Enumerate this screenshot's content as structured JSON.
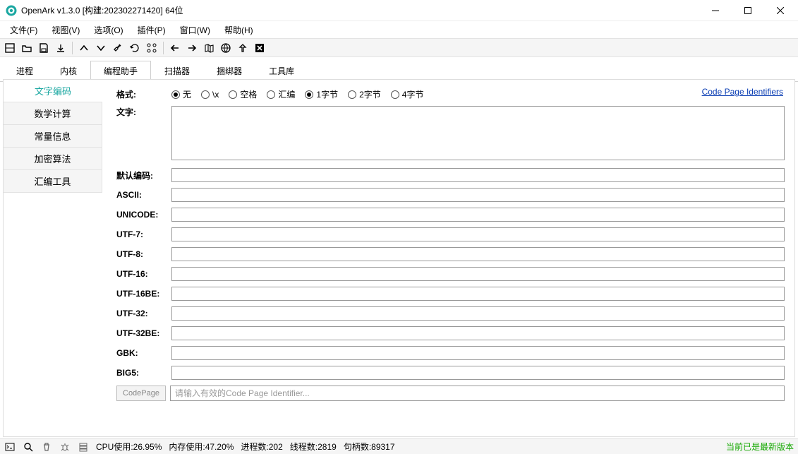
{
  "window": {
    "title": "OpenArk v1.3.0 [构建:202302271420]  64位"
  },
  "menu": {
    "file": "文件(F)",
    "view": "视图(V)",
    "options": "选项(O)",
    "plugins": "插件(P)",
    "windows": "窗口(W)",
    "help": "帮助(H)"
  },
  "tabs": {
    "process": "进程",
    "kernel": "内核",
    "helper": "编程助手",
    "scanner": "扫描器",
    "bundler": "捆绑器",
    "tools": "工具库"
  },
  "sidetabs": {
    "encoding": "文字编码",
    "math": "数学计算",
    "consts": "常量信息",
    "crypto": "加密算法",
    "asm": "汇编工具"
  },
  "content": {
    "format_label": "格式:",
    "text_label": "文字:",
    "codepage_link": "Code Page Identifiers",
    "radios": {
      "none": "无",
      "slashx": "\\x",
      "space": "空格",
      "asm": "汇编",
      "b1": "1字节",
      "b2": "2字节",
      "b4": "4字节"
    },
    "fields": {
      "default": "默认编码:",
      "ascii": "ASCII:",
      "unicode": "UNICODE:",
      "utf7": "UTF-7:",
      "utf8": "UTF-8:",
      "utf16": "UTF-16:",
      "utf16be": "UTF-16BE:",
      "utf32": "UTF-32:",
      "utf32be": "UTF-32BE:",
      "gbk": "GBK:",
      "big5": "BIG5:"
    },
    "codepage_btn": "CodePage",
    "codepage_placeholder": "请输入有效的Code Page Identifier..."
  },
  "status": {
    "cpu": "CPU使用:26.95%",
    "mem": "内存使用:47.20%",
    "proc": "进程数:202",
    "thread": "线程数:2819",
    "handle": "句柄数:89317",
    "latest": "当前已是最新版本"
  }
}
